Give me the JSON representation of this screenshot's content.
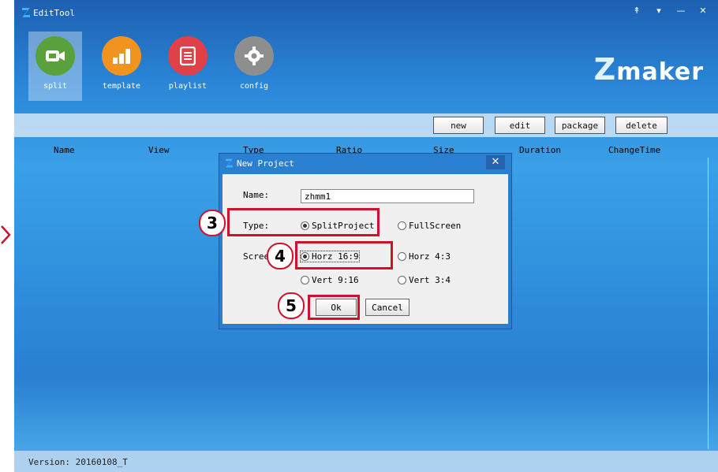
{
  "window": {
    "title": "EditTool",
    "controls": [
      "↟",
      "▾",
      "—",
      "✕"
    ]
  },
  "toolbar": {
    "tools": [
      {
        "label": "split",
        "icon": "video-camera-icon",
        "color": "#5aa03b"
      },
      {
        "label": "template",
        "icon": "bar-chart-icon",
        "color": "#f0931f"
      },
      {
        "label": "playlist",
        "icon": "document-icon",
        "color": "#e04048"
      },
      {
        "label": "config",
        "icon": "gear-icon",
        "color": "#8e8e8e"
      }
    ]
  },
  "brand": {
    "z": "Z",
    "rest": "maker"
  },
  "actions": {
    "new": "new",
    "edit": "edit",
    "package": "package",
    "delete": "delete"
  },
  "columns": [
    "Name",
    "View",
    "Type",
    "Ratio",
    "Size",
    "Duration",
    "ChangeTime"
  ],
  "status": {
    "version": "Version: 20160108_T"
  },
  "dialog": {
    "title": "New Project",
    "close": "✕",
    "name_label": "Name:",
    "name_value": "zhmm1",
    "type_label": "Type:",
    "type_options": [
      "SplitProject",
      "FullScreen"
    ],
    "type_selected": "SplitProject",
    "screen_label": "Screen:",
    "screen_options": [
      "Horz 16:9",
      "Horz 4:3",
      "Vert 9:16",
      "Vert 3:4"
    ],
    "screen_selected": "Horz 16:9",
    "ok": "Ok",
    "cancel": "Cancel"
  },
  "annotations": {
    "step3": "3",
    "step4": "4",
    "step5": "5",
    "color": "#d0112b"
  }
}
